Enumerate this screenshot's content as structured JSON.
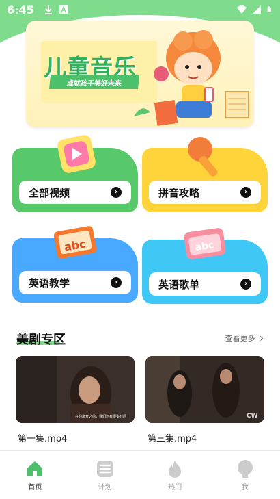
{
  "status_bar": {
    "time": "6:45"
  },
  "banner": {
    "title": "儿童音乐",
    "subtitle": "成就孩子美好未来"
  },
  "categories": [
    {
      "label": "全部视频",
      "color": "#57c96a"
    },
    {
      "label": "拼音攻略",
      "color": "#ffd43a"
    },
    {
      "label": "英语教学",
      "color": "#49a8ff"
    },
    {
      "label": "英语歌单",
      "color": "#3fc7f5"
    }
  ],
  "section": {
    "title": "美剧专区",
    "more_label": "查看更多"
  },
  "videos": [
    {
      "label": "第一集.mp4",
      "subtitle": "在你离开之前，我们还有很多时间"
    },
    {
      "label": "第三集.mp4",
      "badge": "CW"
    }
  ],
  "bottom_nav": {
    "items": [
      {
        "label": "首页",
        "icon": "home-icon",
        "active": true
      },
      {
        "label": "计划",
        "icon": "plan-icon",
        "active": false
      },
      {
        "label": "热门",
        "icon": "fire-icon",
        "active": false
      },
      {
        "label": "我",
        "icon": "user-icon",
        "active": false
      }
    ]
  },
  "colors": {
    "accent_green": "#57c96a",
    "nav_active": "#4cc06a",
    "nav_inactive": "#cccccc"
  }
}
